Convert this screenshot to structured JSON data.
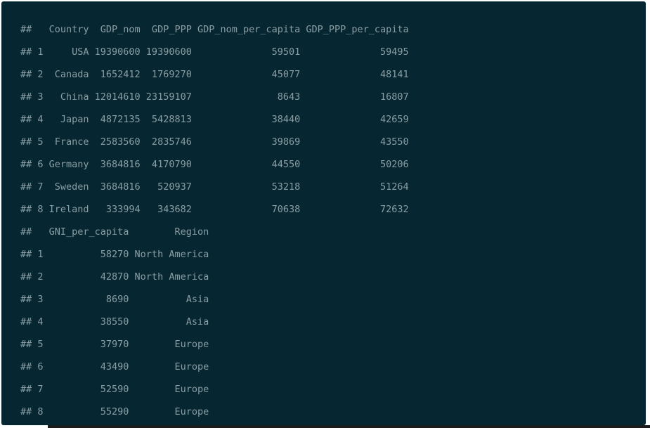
{
  "output_lines": [
    "##   Country  GDP_nom  GDP_PPP GDP_nom_per_capita GDP_PPP_per_capita",
    "## 1     USA 19390600 19390600              59501              59495",
    "## 2  Canada  1652412  1769270              45077              48141",
    "## 3   China 12014610 23159107               8643              16807",
    "## 4   Japan  4872135  5428813              38440              42659",
    "## 5  France  2583560  2835746              39869              43550",
    "## 6 Germany  3684816  4170790              44550              50206",
    "## 7  Sweden  3684816   520937              53218              51264",
    "## 8 Ireland   333994   343682              70638              72632",
    "##   GNI_per_capita        Region",
    "## 1          58270 North America",
    "## 2          42870 North America",
    "## 3           8690          Asia",
    "## 4          38550          Asia",
    "## 5          37970        Europe",
    "## 6          43490        Europe",
    "## 7          52590        Europe",
    "## 8          55290        Europe"
  ]
}
